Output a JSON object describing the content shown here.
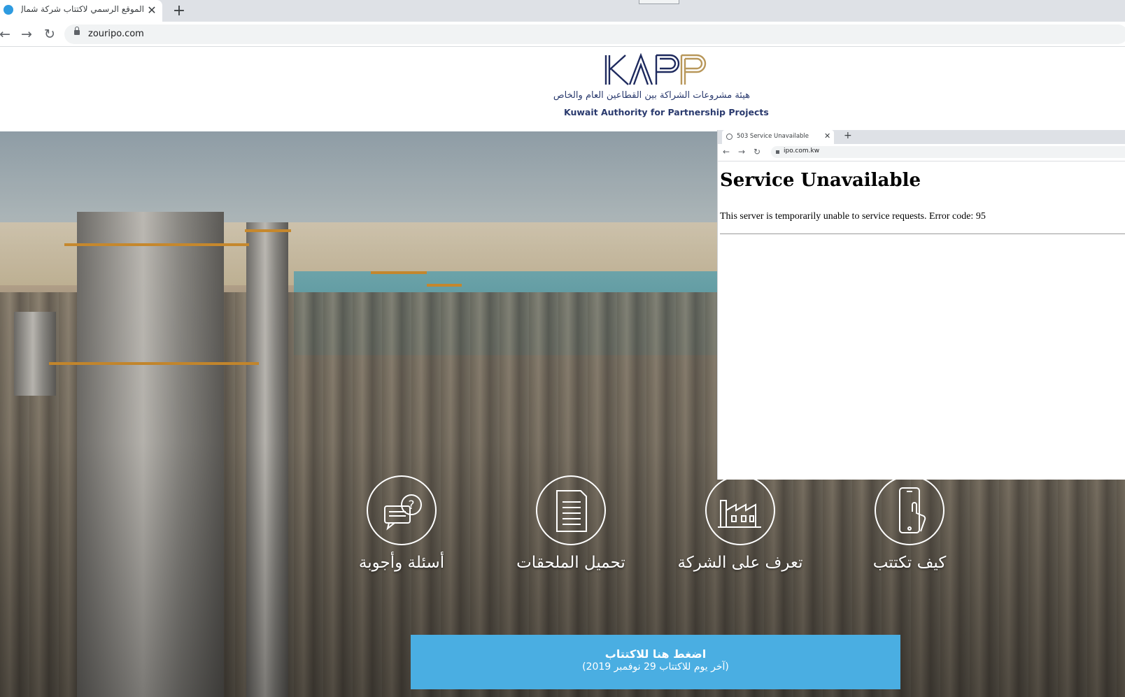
{
  "browser": {
    "tab_title": "الموقع الرسمي لاكتتاب شركة شمال",
    "tab_close": "✕",
    "new_tab": "+",
    "back": "←",
    "forward": "→",
    "reload": "↻",
    "url": "zouripo.com"
  },
  "header": {
    "logo_text": "KAPP",
    "org_name_ar": "هيئة مشروعات الشراكة بين القطاعين العام والخاص",
    "org_name_en": "Kuwait Authority for Partnership Projects"
  },
  "features": [
    {
      "label": "أسئلة وأجوبة",
      "icon": "faq-chat-icon"
    },
    {
      "label": "تحميل الملحقات",
      "icon": "document-icon"
    },
    {
      "label": "تعرف على الشركة",
      "icon": "factory-icon"
    },
    {
      "label": "كيف تكتتب",
      "icon": "phone-tap-icon"
    }
  ],
  "cta": {
    "title": "اضغط هنا للاكتتاب",
    "subtitle": "(آخر يوم للاكتتاب 29 نوفمبر 2019)"
  },
  "inset": {
    "tab_title": "503 Service Unavailable",
    "tab_close": "✕",
    "new_tab": "+",
    "back": "←",
    "forward": "→",
    "reload": "↻",
    "url": "ipo.com.kw",
    "heading": "Service Unavailable",
    "message": "This server is temporarily unable to service requests. Error code: 95"
  },
  "colors": {
    "cta": "#4aaee2",
    "logo_navy": "#1e2a5e",
    "logo_gold": "#b8975a"
  }
}
